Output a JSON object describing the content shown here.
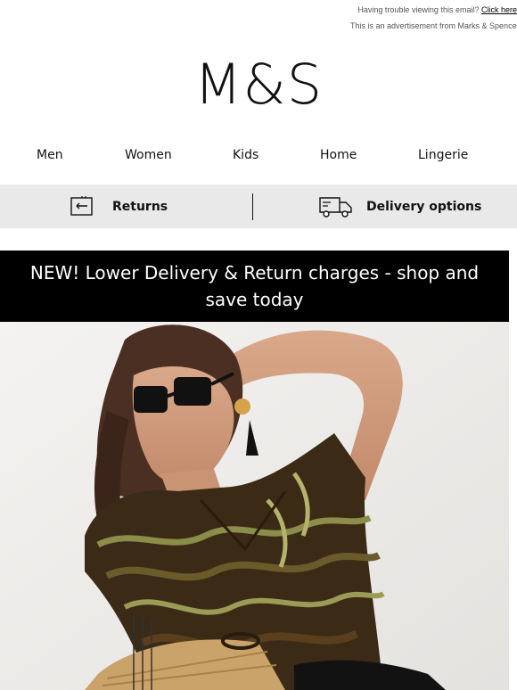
{
  "preheader": {
    "trouble_text": "Having trouble viewing this email?",
    "click_here": "Click here",
    "advert_text": "This is an advertisement from Marks & Spencer"
  },
  "brand": {
    "logo_text": "M&S"
  },
  "nav": {
    "items": [
      {
        "label": "Men"
      },
      {
        "label": "Women"
      },
      {
        "label": "Kids"
      },
      {
        "label": "Home"
      },
      {
        "label": "Lingerie"
      }
    ]
  },
  "services": {
    "returns_label": "Returns",
    "returns_icon": "returns-box-icon",
    "delivery_label": "Delivery options",
    "delivery_icon": "delivery-truck-icon"
  },
  "banner": {
    "text": "NEW! Lower Delivery & Return charges - shop and save today"
  },
  "hero": {
    "description_icon": "hero-photo"
  },
  "colors": {
    "banner_bg": "#000000",
    "service_bg": "#e9e9e9",
    "text": "#111111"
  }
}
